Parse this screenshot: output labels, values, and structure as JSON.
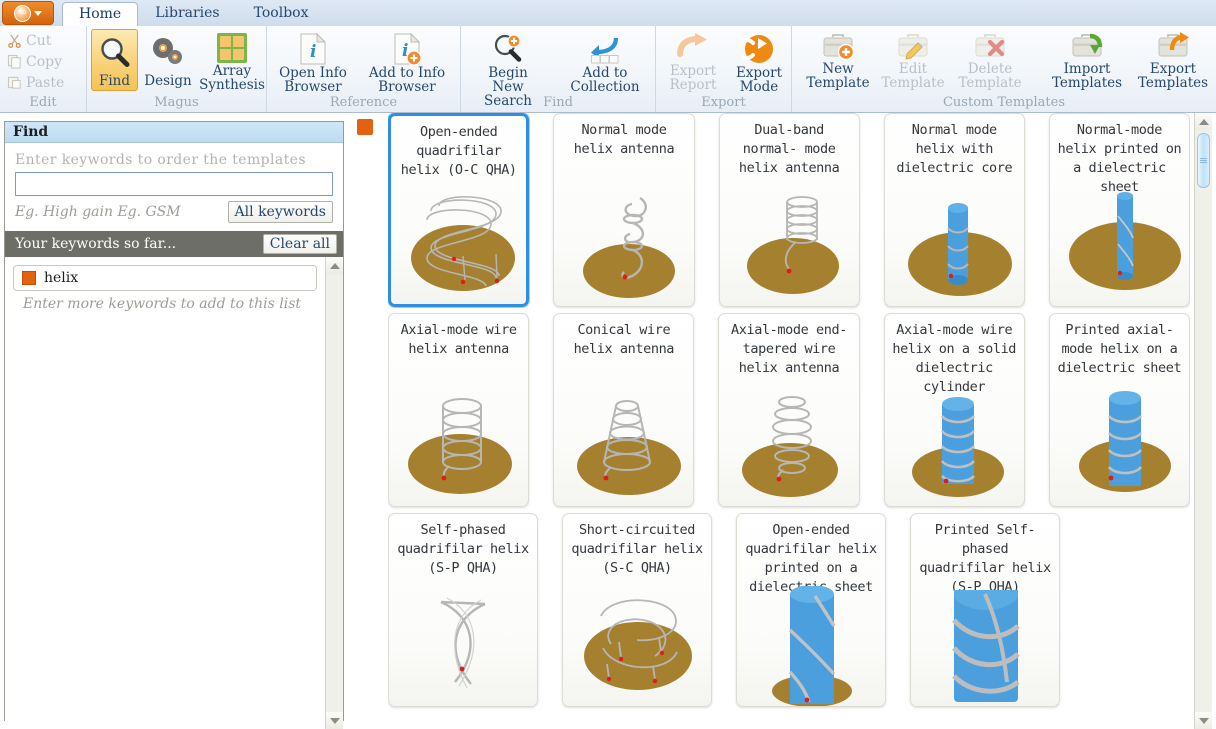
{
  "window": {
    "app_button": {
      "name": "antenna-magus-logo",
      "glyph": "∞"
    },
    "tabs": [
      {
        "label": "Home",
        "active": true
      },
      {
        "label": "Libraries",
        "active": false
      },
      {
        "label": "Toolbox",
        "active": false
      }
    ]
  },
  "ribbon": {
    "groups": [
      {
        "title": "Edit",
        "type": "stack",
        "items": [
          {
            "label": "Cut",
            "icon": "scissors-icon",
            "disabled": true
          },
          {
            "label": "Copy",
            "icon": "copy-icon",
            "disabled": true
          },
          {
            "label": "Paste",
            "icon": "paste-icon",
            "disabled": true
          }
        ]
      },
      {
        "title": "Magus",
        "type": "big",
        "items": [
          {
            "label": "Find",
            "icon": "magnifier-icon",
            "selected": true,
            "disabled": false
          },
          {
            "label": "Design",
            "icon": "gears-icon",
            "selected": false,
            "disabled": false
          },
          {
            "label": "Array\nSynthesis",
            "icon": "grid-green-icon",
            "selected": false,
            "disabled": false
          }
        ]
      },
      {
        "title": "Reference",
        "type": "big",
        "items": [
          {
            "label": "Open Info\nBrowser",
            "icon": "info-document-icon",
            "selected": false,
            "disabled": false
          },
          {
            "label": "Add to Info\nBrowser",
            "icon": "info-document-add-icon",
            "selected": false,
            "disabled": false
          }
        ]
      },
      {
        "title": "Find",
        "type": "big",
        "items": [
          {
            "label": "Begin New\nSearch",
            "icon": "magnifier-plus-icon",
            "selected": false,
            "disabled": false
          },
          {
            "label": "Add to\nCollection",
            "icon": "blue-arrow-collection-icon",
            "selected": false,
            "disabled": false
          }
        ]
      },
      {
        "title": "Export",
        "type": "big",
        "items": [
          {
            "label": "Export\nReport",
            "icon": "export-arrow-icon",
            "selected": false,
            "disabled": true
          },
          {
            "label": "Export\nMode",
            "icon": "export-circle-arrow-icon",
            "selected": false,
            "disabled": false
          }
        ]
      },
      {
        "title": "Custom Templates",
        "type": "big",
        "items": [
          {
            "label": "New\nTemplate",
            "icon": "briefcase-add-icon",
            "selected": false,
            "disabled": false
          },
          {
            "label": "Edit\nTemplate",
            "icon": "briefcase-pencil-icon",
            "selected": false,
            "disabled": true
          },
          {
            "label": "Delete\nTemplate",
            "icon": "briefcase-delete-icon",
            "selected": false,
            "disabled": true
          },
          {
            "label": "Import\nTemplates",
            "icon": "briefcase-import-icon",
            "selected": false,
            "disabled": false
          },
          {
            "label": "Export\nTemplates",
            "icon": "briefcase-export-icon",
            "selected": false,
            "disabled": false
          }
        ]
      }
    ]
  },
  "find_panel": {
    "header_title": "Find",
    "hint": "Enter keywords to order the templates",
    "search_value": "",
    "search_placeholder": "",
    "examples": "Eg. High gain  Eg. GSM",
    "all_keywords_label": "All keywords",
    "keywords_bar_label": "Your keywords so far...",
    "clear_all_label": "Clear all",
    "keywords": [
      {
        "label": "helix",
        "color": "#e4610f"
      }
    ],
    "add_more_hint": "Enter more keywords to add to this list"
  },
  "templates": {
    "rows": [
      [
        {
          "title": "Open-ended\nquadrifilar helix\n(O-C QHA)",
          "art": "qha-open-wire",
          "selected": true
        },
        {
          "title": "Normal mode helix\nantenna",
          "art": "normal-mode-wire",
          "selected": false
        },
        {
          "title": "Dual-band normal-\nmode helix\nantenna",
          "art": "dualband-wire",
          "selected": false
        },
        {
          "title": "Normal mode helix\nwith dielectric\ncore",
          "art": "thin-cylinder-coil",
          "selected": false
        },
        {
          "title": "Normal-mode helix\nprinted on a\ndielectric sheet",
          "art": "thin-cylinder-print",
          "selected": false
        }
      ],
      [
        {
          "title": "Axial-mode wire\nhelix antenna",
          "art": "axial-wire-coil",
          "selected": false
        },
        {
          "title": "Conical wire\nhelix antenna",
          "art": "conical-wire-coil",
          "selected": false
        },
        {
          "title": "Axial-mode end-\ntapered wire\nhelix antenna",
          "art": "tapered-wire-coil",
          "selected": false
        },
        {
          "title": "Axial-mode wire\nhelix on a solid\ndielectric\ncylinder",
          "art": "cylinder-coil",
          "selected": false
        },
        {
          "title": "Printed axial-\nmode helix on a\ndielectric sheet",
          "art": "cylinder-print-coil",
          "selected": false
        }
      ],
      [
        {
          "title": "Self-phased\nquadrifilar helix\n(S-P QHA)",
          "art": "sp-qha-wire",
          "selected": false
        },
        {
          "title": "Short-circuited\nquadrifilar helix\n(S-C QHA)",
          "art": "sc-qha-wire",
          "selected": false
        },
        {
          "title": "Open-ended\nquadrifilar helix\nprinted on a\ndielectric sheet",
          "art": "printed-qha-cylinder",
          "selected": false
        },
        {
          "title": "Printed Self-\nphased\nquadrifilar helix\n(S-P QHA)",
          "art": "printed-sp-qha-cylinder",
          "selected": false
        }
      ]
    ]
  },
  "colors": {
    "accent_orange": "#e4610f",
    "selection_blue": "#2e8fe0",
    "ground_brown": "#a5812f",
    "dielectric_blue": "#4a9fdc",
    "wire_grey": "#b6b6b6",
    "feed_red": "#e01b1b"
  }
}
